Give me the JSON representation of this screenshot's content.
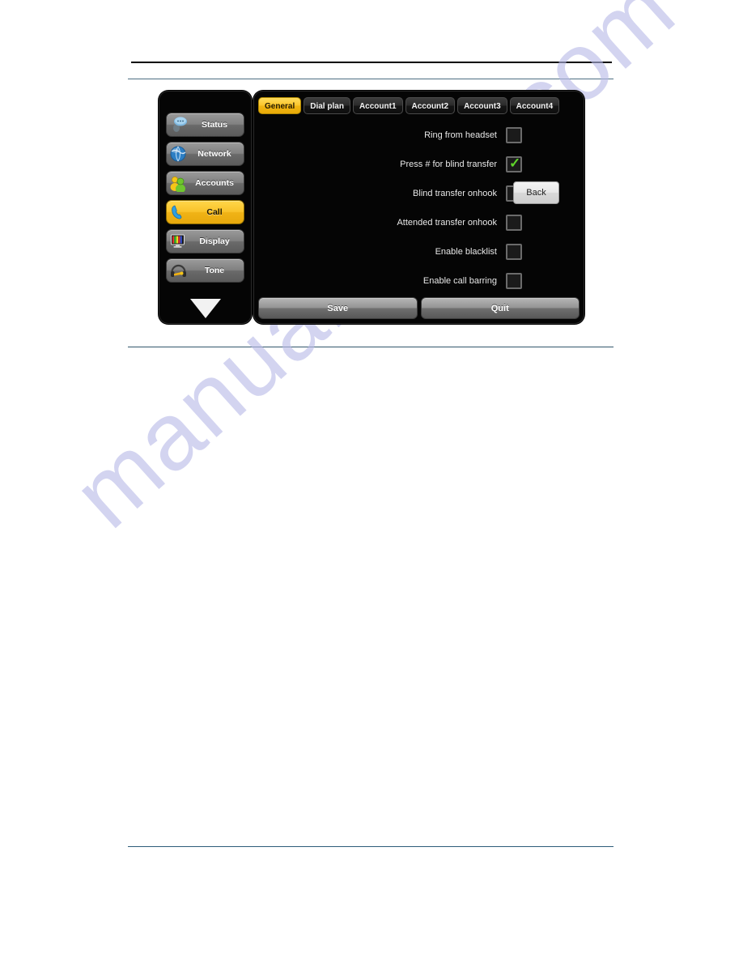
{
  "page": {
    "watermark": "manualshive.com"
  },
  "device": {
    "sidebar": {
      "items": [
        {
          "label": "Status",
          "icon": "status-icon",
          "active": false
        },
        {
          "label": "Network",
          "icon": "network-icon",
          "active": false
        },
        {
          "label": "Accounts",
          "icon": "accounts-icon",
          "active": false
        },
        {
          "label": "Call",
          "icon": "call-icon",
          "active": true
        },
        {
          "label": "Display",
          "icon": "display-icon",
          "active": false
        },
        {
          "label": "Tone",
          "icon": "tone-icon",
          "active": false
        }
      ],
      "scroll_down_icon": "chevron-down-icon"
    },
    "tabs": [
      {
        "label": "General",
        "active": true
      },
      {
        "label": "Dial plan",
        "active": false
      },
      {
        "label": "Account1",
        "active": false
      },
      {
        "label": "Account2",
        "active": false
      },
      {
        "label": "Account3",
        "active": false
      },
      {
        "label": "Account4",
        "active": false
      }
    ],
    "settings": [
      {
        "label": "Ring from headset",
        "checked": false
      },
      {
        "label": "Press # for blind transfer",
        "checked": true
      },
      {
        "label": "Blind transfer onhook",
        "checked": false
      },
      {
        "label": "Attended transfer onhook",
        "checked": false
      },
      {
        "label": "Enable blacklist",
        "checked": false
      },
      {
        "label": "Enable call barring",
        "checked": false
      }
    ],
    "back_button": "Back",
    "footer": {
      "save": "Save",
      "quit": "Quit"
    },
    "colors": {
      "accent": "#f9c32a",
      "panel_bg": "#050505",
      "check": "#5fd42a"
    }
  }
}
